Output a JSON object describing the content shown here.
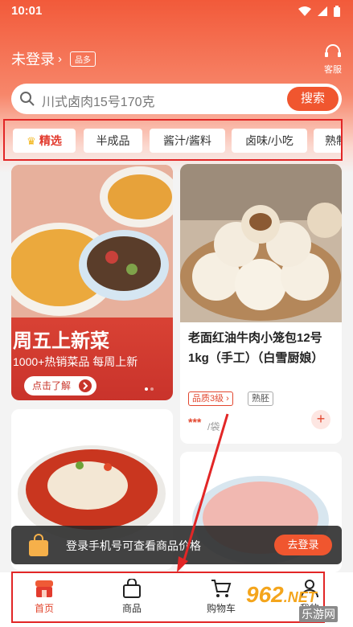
{
  "status_bar": {
    "time": "10:01"
  },
  "header": {
    "login_label": "未登录",
    "login_chevron": "›",
    "quality_chip": "品多",
    "service_label": "客服"
  },
  "search": {
    "placeholder": "川式卤肉15号170克",
    "button_label": "搜索"
  },
  "categories": [
    {
      "label": "精选",
      "active": true,
      "icon": "crown-icon"
    },
    {
      "label": "半成品"
    },
    {
      "label": "酱汁/酱料"
    },
    {
      "label": "卤味/小吃"
    },
    {
      "label": "熟制"
    }
  ],
  "promo": {
    "title": "周五上新菜",
    "subtitle": "1000+热销菜品 每周上新",
    "button_label": "点击了解"
  },
  "product": {
    "name": "老面红油牛肉小笼包12号1kg（手工）（白雪厨娘）",
    "tag_quality": "品质3级 ›",
    "tag_type": "熟胚",
    "price": "***",
    "unit": "/袋",
    "add_label": "+"
  },
  "login_banner": {
    "text": "登录手机号可查看商品价格",
    "button_label": "去登录"
  },
  "tabbar": {
    "items": [
      {
        "label": "首页",
        "icon": "home-shop-icon",
        "active": true
      },
      {
        "label": "商品",
        "icon": "bag-icon"
      },
      {
        "label": "购物车",
        "icon": "cart-icon"
      },
      {
        "label": "我的",
        "icon": "user-icon"
      }
    ]
  },
  "watermark": {
    "number": "962",
    "suffix": ".NET",
    "site": "乐游网"
  },
  "colors": {
    "brand": "#f0562f",
    "highlight_box": "#e22626"
  }
}
